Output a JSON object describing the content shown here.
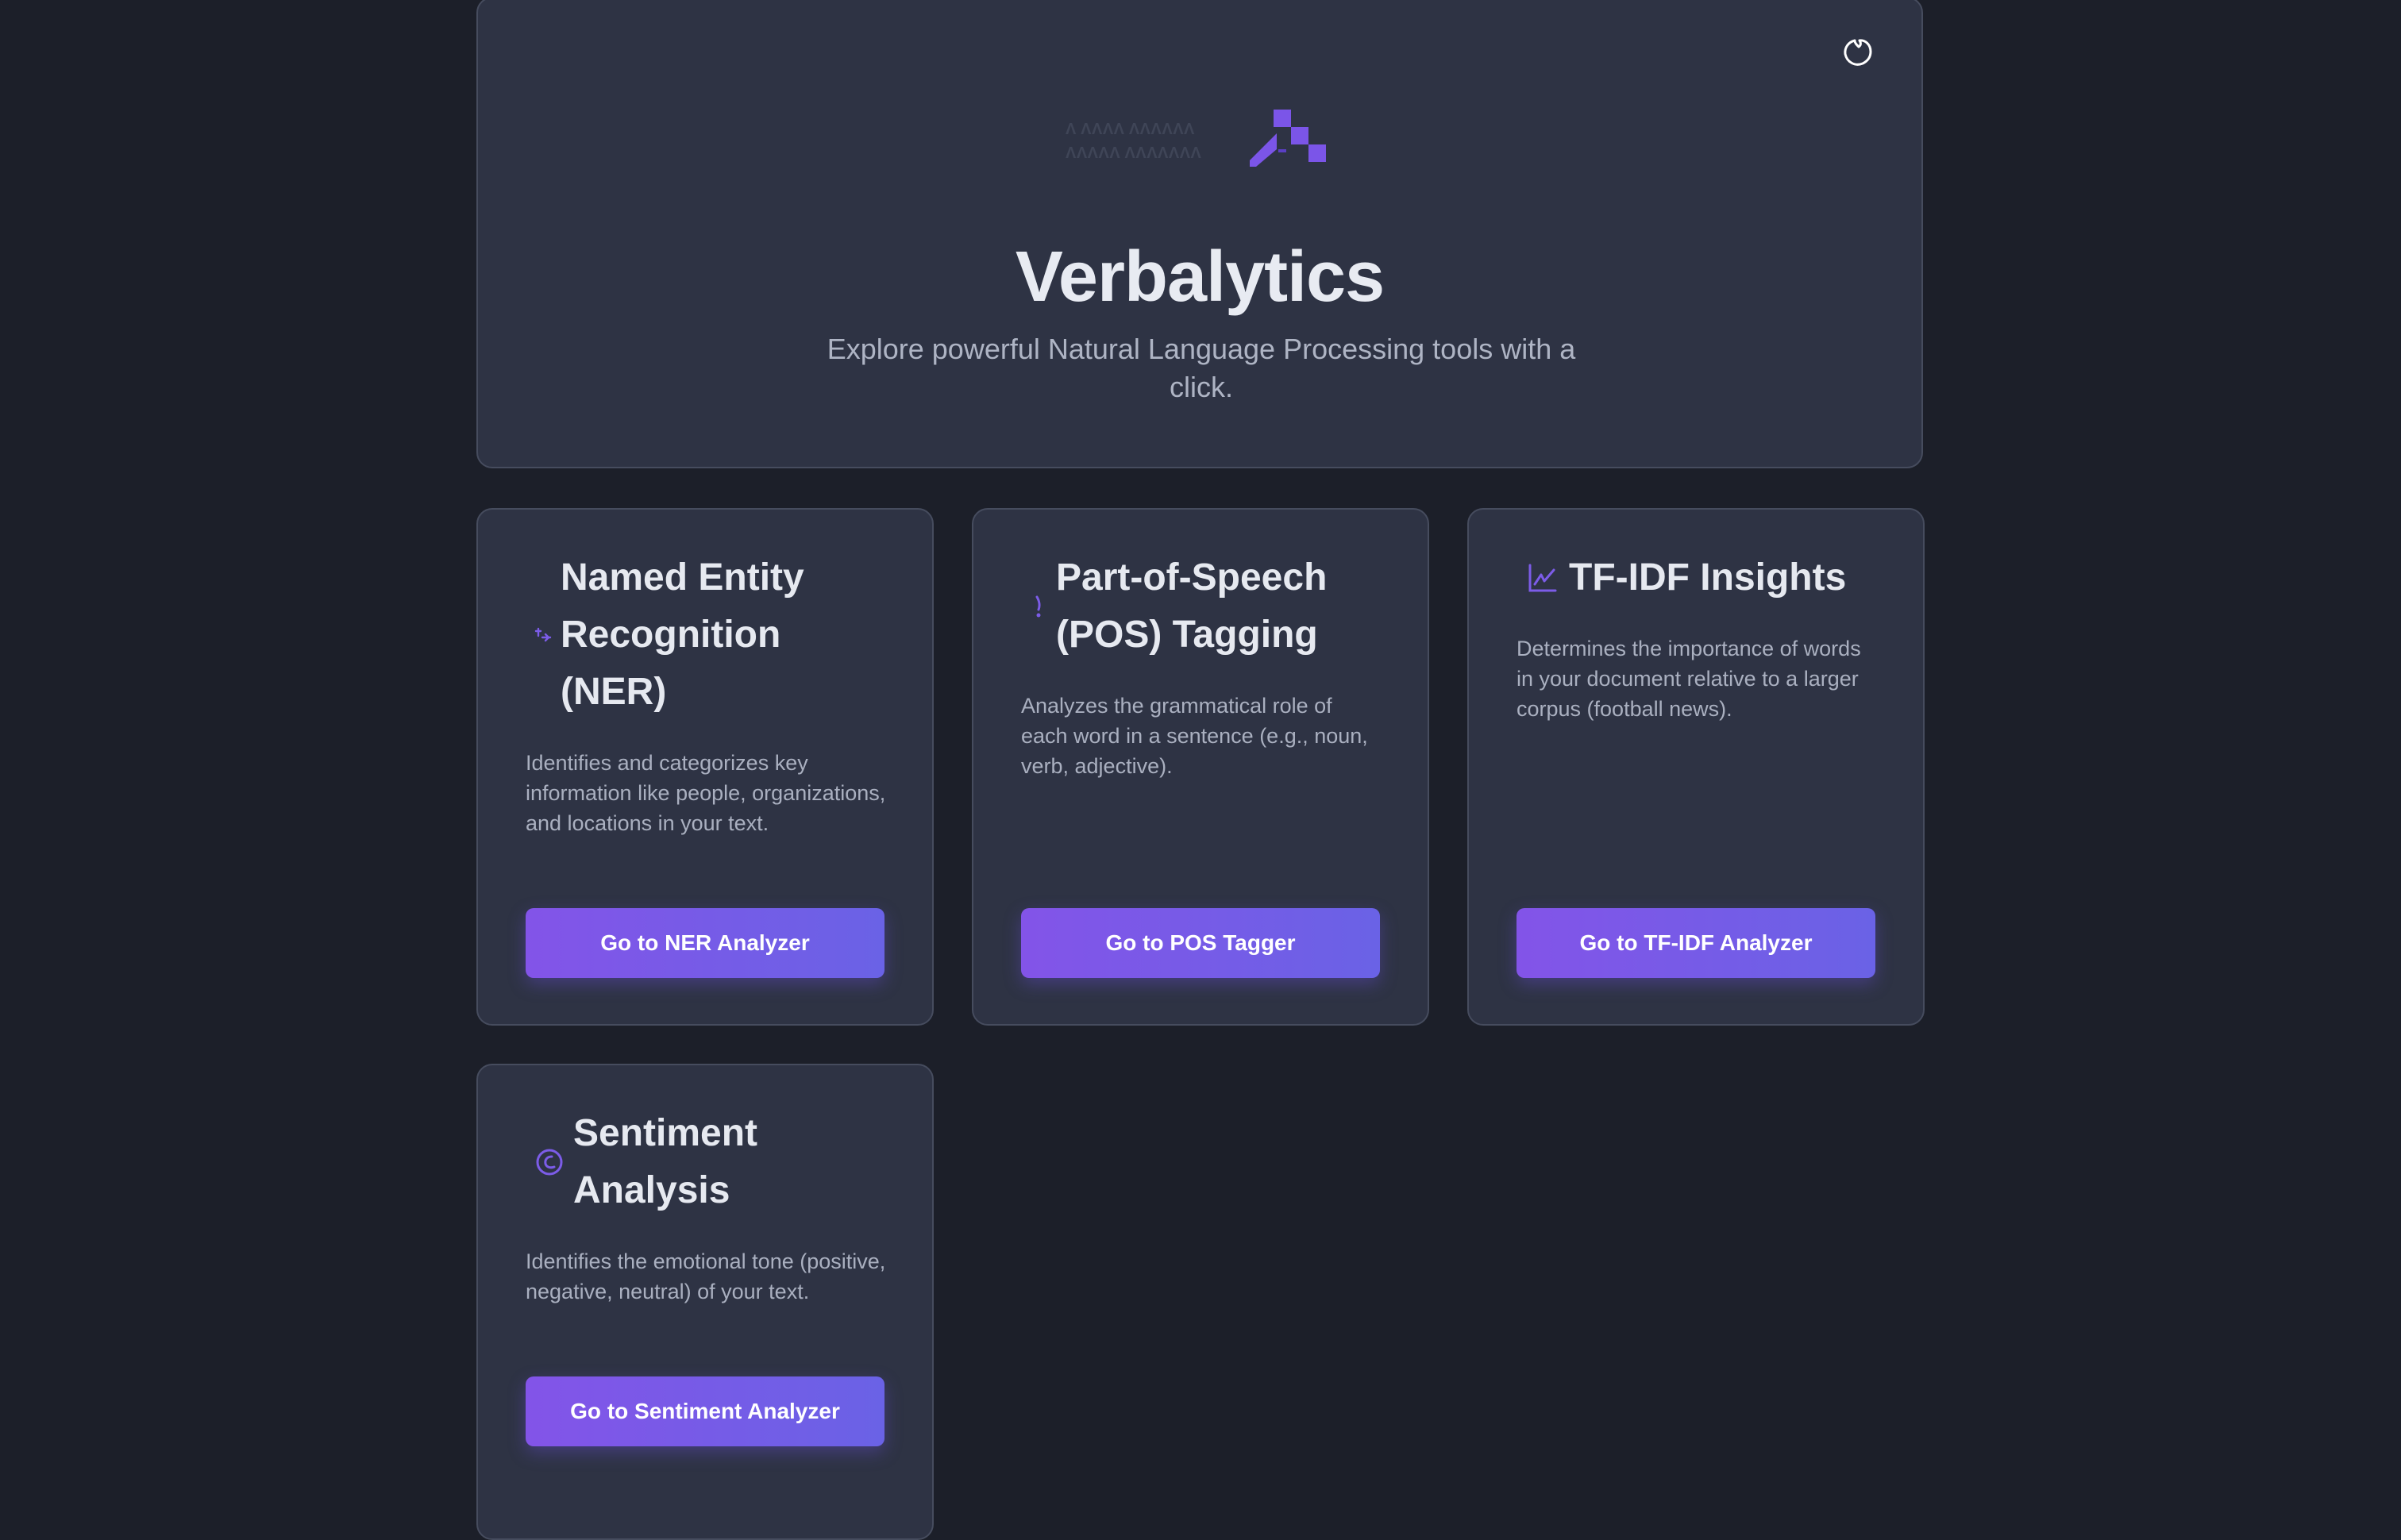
{
  "hero": {
    "logo_lines": [
      "Λ ΛΛΛΛ ΛΛΛΛΛΛ",
      "ΛΛΛΛΛ ΛΛΛΛΛΛΛ"
    ],
    "title": "Verbalytics",
    "subtitle": "Explore powerful Natural Language Processing tools with a click.",
    "theme_toggle_icon": "moon-icon"
  },
  "cards": [
    {
      "icon": "entity-tag-icon",
      "title": "Named Entity Recognition (NER)",
      "description": "Identifies and categorizes key information like people, organizations, and locations in your text.",
      "button": "Go to NER Analyzer"
    },
    {
      "icon": "exclamation-icon",
      "title": "Part-of-Speech (POS) Tagging",
      "description": "Analyzes the grammatical role of each word in a sentence (e.g., noun, verb, adjective).",
      "button": "Go to POS Tagger"
    },
    {
      "icon": "chart-icon",
      "title": "TF-IDF Insights",
      "description": "Determines the importance of words in your document relative to a larger corpus (football news).",
      "button": "Go to TF-IDF Analyzer"
    },
    {
      "icon": "smile-icon",
      "title": "Sentiment Analysis",
      "description": "Identifies the emotional tone (positive, negative, neutral) of your text.",
      "button": "Go to Sentiment Analyzer"
    }
  ],
  "colors": {
    "background": "#1c1f29",
    "card": "#2e3344",
    "border": "#464c5e",
    "accent": "#7c5ce8",
    "button_gradient_start": "#8354e8",
    "button_gradient_end": "#6a62e6"
  }
}
